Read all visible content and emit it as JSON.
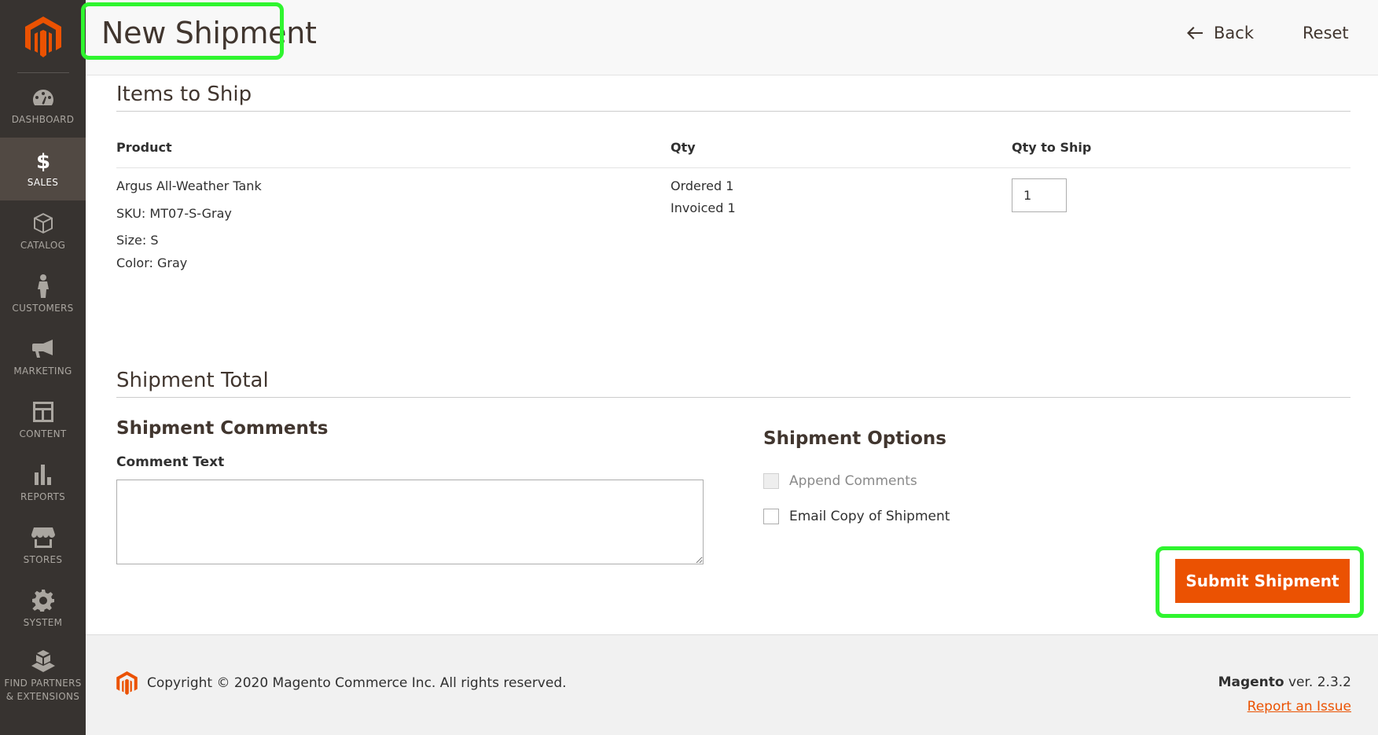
{
  "sidebar": {
    "logo": "magento-logo",
    "items": [
      {
        "label": "DASHBOARD",
        "icon": "dashboard-icon"
      },
      {
        "label": "SALES",
        "icon": "dollar-icon",
        "active": true
      },
      {
        "label": "CATALOG",
        "icon": "box-icon"
      },
      {
        "label": "CUSTOMERS",
        "icon": "person-icon"
      },
      {
        "label": "MARKETING",
        "icon": "megaphone-icon"
      },
      {
        "label": "CONTENT",
        "icon": "layout-icon"
      },
      {
        "label": "REPORTS",
        "icon": "bar-chart-icon"
      },
      {
        "label": "STORES",
        "icon": "storefront-icon"
      },
      {
        "label": "SYSTEM",
        "icon": "gear-icon"
      },
      {
        "label": "FIND PARTNERS & EXTENSIONS",
        "icon": "blocks-icon"
      }
    ]
  },
  "header": {
    "title": "New Shipment",
    "back_label": "Back",
    "reset_label": "Reset"
  },
  "items_to_ship": {
    "title": "Items to Ship",
    "columns": [
      "Product",
      "Qty",
      "Qty to Ship"
    ],
    "row": {
      "product_name": "Argus All-Weather Tank",
      "sku": "SKU: MT07-S-Gray",
      "size": "Size:  S",
      "color": "Color:  Gray",
      "ordered": "Ordered  1",
      "invoiced": "Invoiced  1",
      "qty_to_ship": "1"
    }
  },
  "shipment_total": {
    "title": "Shipment Total",
    "comments_title": "Shipment Comments",
    "comment_label": "Comment Text",
    "comment_value": "",
    "options_title": "Shipment Options",
    "append_comments_label": "Append Comments",
    "email_copy_label": "Email Copy of Shipment",
    "submit_label": "Submit Shipment"
  },
  "footer": {
    "copyright": "Copyright © 2020 Magento Commerce Inc. All rights reserved.",
    "brand": "Magento",
    "version": " ver. 2.3.2",
    "report_link": "Report an Issue"
  },
  "colors": {
    "sidebar_bg": "#373330",
    "sidebar_active": "#514943",
    "accent": "#eb5202",
    "highlight": "#2ff52f"
  }
}
